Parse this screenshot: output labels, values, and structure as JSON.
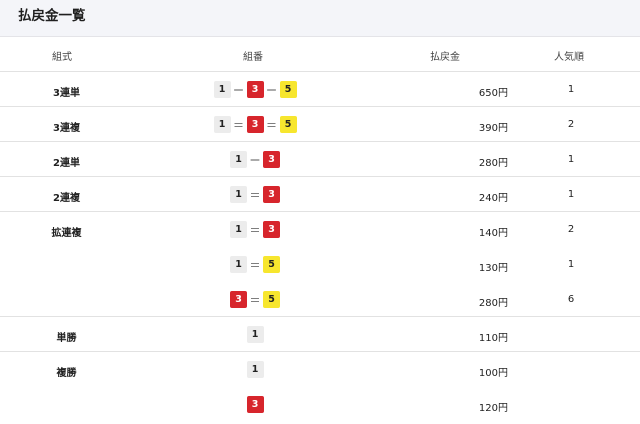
{
  "title": "払戻金一覧",
  "columns": {
    "type": "組式",
    "combination": "組番",
    "payout": "払戻金",
    "popularity": "人気順"
  },
  "colors": {
    "1": "#ececec",
    "3": "#d7252c",
    "5": "#f7e62e"
  },
  "text_colors": {
    "1": "#222222",
    "3": "#ffffff",
    "5": "#222222"
  },
  "rows": [
    {
      "type": "3連単",
      "combo": [
        "1",
        "3",
        "5"
      ],
      "sep": "ー",
      "payout": "650円",
      "pop": "1",
      "end": true
    },
    {
      "type": "3連複",
      "combo": [
        "1",
        "3",
        "5"
      ],
      "sep": "＝",
      "payout": "390円",
      "pop": "2",
      "end": true
    },
    {
      "type": "2連単",
      "combo": [
        "1",
        "3"
      ],
      "sep": "ー",
      "payout": "280円",
      "pop": "1",
      "end": true
    },
    {
      "type": "2連複",
      "combo": [
        "1",
        "3"
      ],
      "sep": "＝",
      "payout": "240円",
      "pop": "1",
      "end": true
    },
    {
      "type": "拡連複",
      "combo": [
        "1",
        "3"
      ],
      "sep": "＝",
      "payout": "140円",
      "pop": "2",
      "end": false
    },
    {
      "type": "",
      "combo": [
        "1",
        "5"
      ],
      "sep": "＝",
      "payout": "130円",
      "pop": "1",
      "end": false
    },
    {
      "type": "",
      "combo": [
        "3",
        "5"
      ],
      "sep": "＝",
      "payout": "280円",
      "pop": "6",
      "end": true
    },
    {
      "type": "単勝",
      "combo": [
        "1"
      ],
      "sep": "",
      "payout": "110円",
      "pop": "",
      "end": true
    },
    {
      "type": "複勝",
      "combo": [
        "1"
      ],
      "sep": "",
      "payout": "100円",
      "pop": "",
      "end": false
    },
    {
      "type": "",
      "combo": [
        "3"
      ],
      "sep": "",
      "payout": "120円",
      "pop": "",
      "end": false
    }
  ]
}
